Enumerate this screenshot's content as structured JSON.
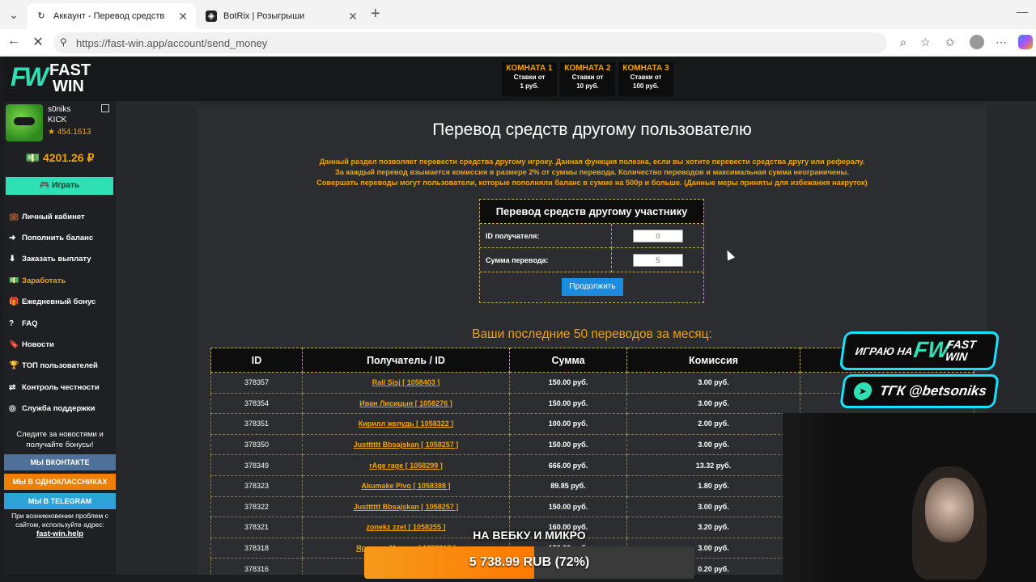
{
  "browser": {
    "tabs": [
      {
        "title": "Аккаунт - Перевод средств",
        "icon": "loading-icon",
        "active": true
      },
      {
        "title": "BotRix | Розыгрыши",
        "icon": "botrix-icon",
        "active": false
      }
    ],
    "url": "https://fast-win.app/account/send_money"
  },
  "site": {
    "logo": {
      "mark": "FW",
      "line1": "FAST",
      "line2": "WIN"
    },
    "rooms": [
      {
        "title": "КОМНАТА 1",
        "line1": "Ставки от",
        "line2": "1 руб."
      },
      {
        "title": "КОМНАТА 2",
        "line1": "Ставки от",
        "line2": "10 руб."
      },
      {
        "title": "КОМНАТА 3",
        "line1": "Ставки от",
        "line2": "100 руб."
      }
    ]
  },
  "sidebar": {
    "user": {
      "name": "s0niks",
      "tag": "KICK",
      "rating": "★ 454.1613"
    },
    "balance": "💵 4201.26 ₽",
    "play_label": "🎮 Играть",
    "menu": [
      {
        "label": "Личный кабинет",
        "icon": "briefcase-icon",
        "glyph": "💼"
      },
      {
        "label": "Пополнить баланс",
        "icon": "arrow-circle-right-icon",
        "glyph": "➜"
      },
      {
        "label": "Заказать выплату",
        "icon": "arrow-circle-down-icon",
        "glyph": "⬇"
      },
      {
        "label": "Заработать",
        "icon": "money-icon",
        "glyph": "💵",
        "highlight": true
      },
      {
        "label": "Ежедневный бонус",
        "icon": "gift-icon",
        "glyph": "🎁"
      },
      {
        "label": "FAQ",
        "icon": "question-icon",
        "glyph": "?"
      },
      {
        "label": "Новости",
        "icon": "bookmark-icon",
        "glyph": "🔖"
      },
      {
        "label": "ТОП пользователей",
        "icon": "trophy-icon",
        "glyph": "🏆"
      },
      {
        "label": "Контроль честности",
        "icon": "shuffle-icon",
        "glyph": "⇄"
      },
      {
        "label": "Служба поддержки",
        "icon": "support-icon",
        "glyph": "◎"
      }
    ],
    "follow_text": "Следите за новостями и получайте бонусы!",
    "social": {
      "vk": "МЫ ВКОНТАКТЕ",
      "ok": "МЫ В ОДНОКЛАССНИКАХ",
      "tg": "МЫ В TELEGRAM"
    },
    "problem_text": "При возникновении проблем с сайтом, используйте адрес:",
    "problem_link": "fast-win.help"
  },
  "main": {
    "title": "Перевод средств другому пользователю",
    "description": [
      "Данный раздел позволяет перевести средства другому игроку. Данная функция полезна, если вы хотите перевести средства другу или рефералу.",
      "За каждый перевод взымается комиссия в размере 2% от суммы перевода. Количество переводов и максимальная сумма неограничены.",
      "Совершать переводы могут пользователи, которые пополняли баланс в сумме на 500р и больше. (Данные меры приняты для избежания накруток)"
    ],
    "form": {
      "title": "Перевод средств другому участнику",
      "recipient_label": "ID получателя:",
      "recipient_value": "0",
      "amount_label": "Сумма перевода:",
      "amount_value": "5",
      "submit_label": "Продолжить"
    },
    "history": {
      "title": "Ваши последние 50 переводов за месяц:",
      "columns": [
        "ID",
        "Получатель / ID",
        "Сумма",
        "Комиссия"
      ],
      "rows": [
        {
          "id": "378357",
          "recipient": "Rail Sjsj [ 1058403 ]",
          "amount": "150.00 руб.",
          "fee": "3.00 руб."
        },
        {
          "id": "378354",
          "recipient": "Иван Лисицын [ 1058276 ]",
          "amount": "150.00 руб.",
          "fee": "3.00 руб."
        },
        {
          "id": "378351",
          "recipient": "Кирилл желудь [ 1058322 ]",
          "amount": "100.00 руб.",
          "fee": "2.00 руб."
        },
        {
          "id": "378350",
          "recipient": "Justttttt Bbsajskan [ 1058257 ]",
          "amount": "150.00 руб.",
          "fee": "3.00 руб."
        },
        {
          "id": "378349",
          "recipient": "rAge rage [ 1058299 ]",
          "amount": "666.00 руб.",
          "fee": "13.32 руб."
        },
        {
          "id": "378323",
          "recipient": "Akumake Pivo [ 1058388 ]",
          "amount": "89.85 руб.",
          "fee": "1.80 руб."
        },
        {
          "id": "378322",
          "recipient": "Justttttt Bbsajskan [ 1058257 ]",
          "amount": "150.00 руб.",
          "fee": "3.00 руб."
        },
        {
          "id": "378321",
          "recipient": "zonekz zzet [ 1058255 ]",
          "amount": "160.00 руб.",
          "fee": "3.20 руб."
        },
        {
          "id": "378318",
          "recipient": "Ярослав Митчел [ 1058317 ]",
          "amount": "150.00 руб.",
          "fee": "3.00 руб."
        },
        {
          "id": "378316",
          "recipient": "",
          "amount": "",
          "fee": "0.20 руб."
        }
      ]
    }
  },
  "stream": {
    "fw_banner": {
      "prefix": "ИГРАЮ НА",
      "mark": "FW",
      "line1": "FAST",
      "line2": "WIN"
    },
    "tg_banner": "ТГК @betsoniks",
    "goal_title": "НА ВЕБКУ И МИКРО",
    "goal_value": "5 738.99 RUB (72%)",
    "goal_progress": 0.72
  },
  "colors": {
    "accent": "#f0a500",
    "brand": "#2ee0b4",
    "button": "#1a8de0"
  }
}
